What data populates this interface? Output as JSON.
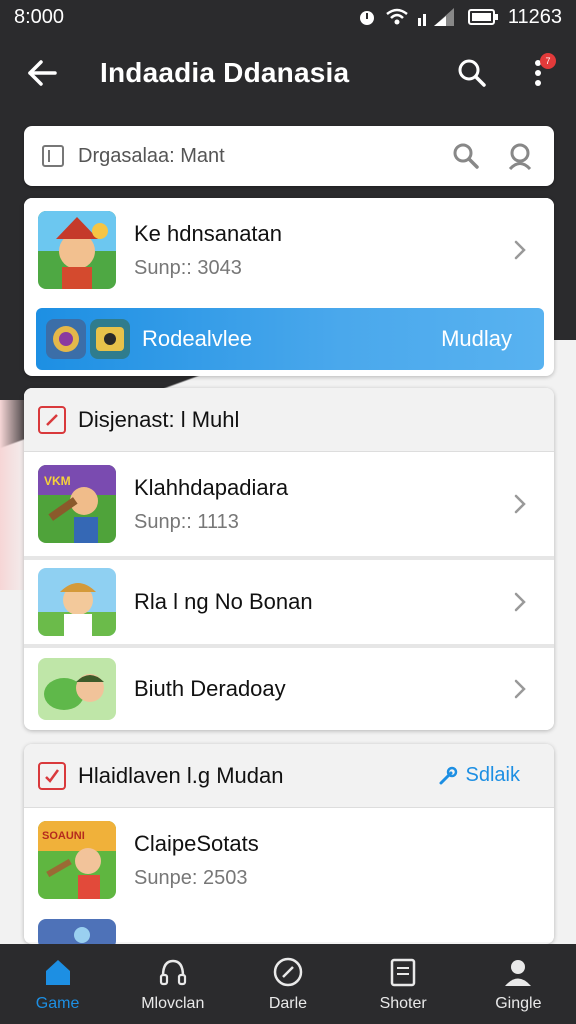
{
  "status_bar": {
    "time": "8:000",
    "clock_right": "11263"
  },
  "app_bar": {
    "title": "Indaadia Ddanasia",
    "more_badge": "7"
  },
  "search": {
    "placeholder": "Drgasalaa: Mant"
  },
  "featured": {
    "item": {
      "title": "Ke hdnsanatan",
      "subtitle": "Sunp:: 3043"
    },
    "promo": {
      "label": "Rodealvlee",
      "action": "Mudlay"
    }
  },
  "section1": {
    "title": "Disjenast: l Muhl",
    "items": [
      {
        "title": "Klahhdapadiara",
        "subtitle": "Sunp:: 1113"
      },
      {
        "title": "Rla l ng No Bonan",
        "subtitle": ""
      },
      {
        "title": "Biuth Deradoay",
        "subtitle": ""
      }
    ]
  },
  "section2": {
    "title": "Hlaidlaven l.g Mudan",
    "action": "Sdlaik",
    "items": [
      {
        "title": "ClaipeSotats",
        "subtitle": "Sunpe: 2503"
      }
    ]
  },
  "bottom_nav": [
    {
      "label": "Game",
      "icon": "home-icon",
      "active": true
    },
    {
      "label": "Mlovclan",
      "icon": "headset-icon",
      "active": false
    },
    {
      "label": "Darle",
      "icon": "compass-icon",
      "active": false
    },
    {
      "label": "Shoter",
      "icon": "clipboard-icon",
      "active": false
    },
    {
      "label": "Gingle",
      "icon": "profile-icon",
      "active": false
    }
  ],
  "colors": {
    "accent": "#1d8fe3",
    "dark_bg": "#2b2b2d",
    "section_icon": "#d9393c"
  }
}
